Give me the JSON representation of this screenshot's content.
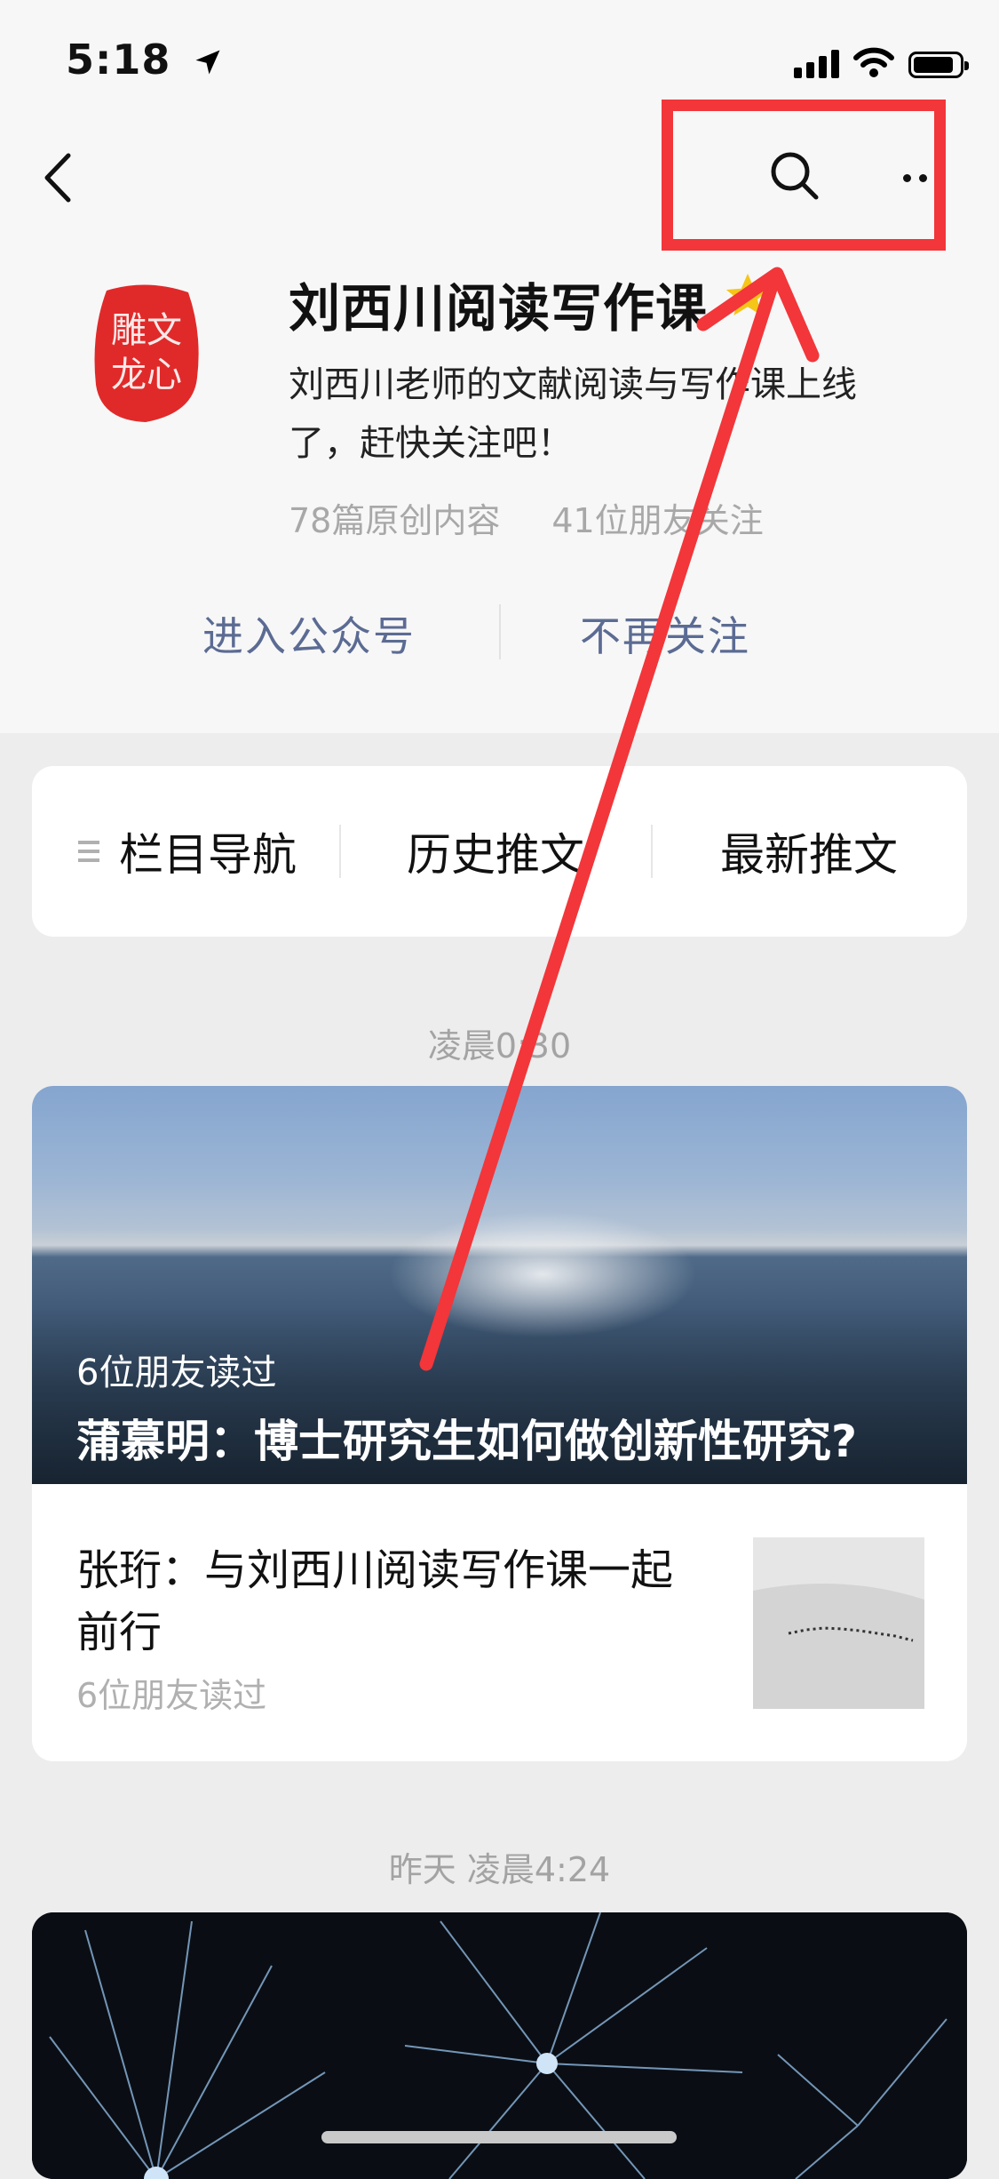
{
  "status_bar": {
    "time": "5:18",
    "location_icon": "location-arrow-icon",
    "signal_icon": "cellular-signal-icon",
    "wifi_icon": "wifi-icon",
    "battery_icon": "battery-icon"
  },
  "nav": {
    "back_icon": "chevron-left-icon",
    "search_icon": "search-icon",
    "more_icon": "more-dots-icon"
  },
  "account": {
    "avatar_icon": "seal-stamp-logo",
    "name": "刘西川阅读写作课",
    "badge_icon": "star-icon",
    "description": "刘西川老师的文献阅读与写作课上线了，赶快关注吧！",
    "original_count": "78篇原创内容",
    "friends_following": "41位朋友关注",
    "enter_label": "进入公众号",
    "unfollow_label": "不再关注"
  },
  "menu": {
    "items": [
      {
        "label": "栏目导航",
        "icon": "hamburger-icon"
      },
      {
        "label": "历史推文"
      },
      {
        "label": "最新推文"
      }
    ]
  },
  "feed": {
    "groups": [
      {
        "time": "凌晨0:30",
        "cover": {
          "readers": "6位朋友读过",
          "title": "蒲慕明：博士研究生如何做创新性研究?"
        },
        "sub": {
          "title": "张珩：与刘西川阅读写作课一起前行",
          "readers": "6位朋友读过"
        }
      },
      {
        "time": "昨天 凌晨4:24"
      }
    ]
  },
  "annotation": {
    "color": "#f2363a",
    "shape": "arrow pointing to highlighted search and more buttons"
  },
  "colors": {
    "link": "#5b6b93",
    "muted": "#a3a3a3",
    "background": "#ededed",
    "annotation_red": "#f2363a"
  }
}
